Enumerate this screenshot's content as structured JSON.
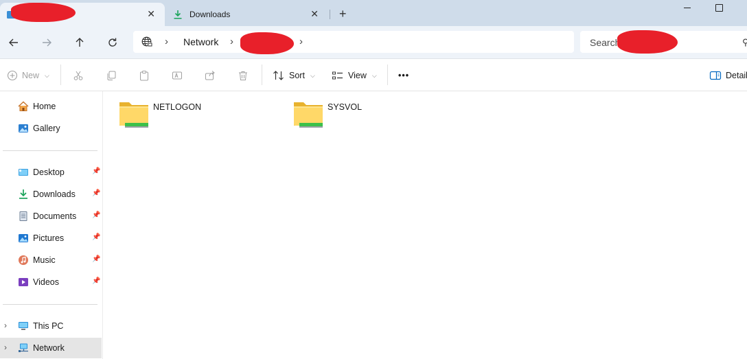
{
  "tabs": [
    {
      "label": "",
      "close": "✕"
    },
    {
      "label": "Downloads",
      "close": "✕"
    }
  ],
  "new_tab": "+",
  "address": {
    "crumbs": [
      "Network"
    ]
  },
  "search": {
    "placeholder": "Search"
  },
  "commands": {
    "new": "New",
    "sort": "Sort",
    "view": "View",
    "more": "•••",
    "details": "Details"
  },
  "sidebar": {
    "top": [
      {
        "label": "Home",
        "icon": "home-icon"
      },
      {
        "label": "Gallery",
        "icon": "gallery-icon"
      }
    ],
    "quick": [
      {
        "label": "Desktop",
        "icon": "desktop-icon"
      },
      {
        "label": "Downloads",
        "icon": "download-icon"
      },
      {
        "label": "Documents",
        "icon": "document-icon"
      },
      {
        "label": "Pictures",
        "icon": "pictures-icon"
      },
      {
        "label": "Music",
        "icon": "music-icon"
      },
      {
        "label": "Videos",
        "icon": "videos-icon"
      }
    ],
    "drives": [
      {
        "label": "This PC",
        "icon": "pc-icon"
      },
      {
        "label": "Network",
        "icon": "network-icon",
        "selected": true
      }
    ]
  },
  "folders": [
    {
      "name": "NETLOGON"
    },
    {
      "name": "SYSVOL"
    }
  ],
  "colors": {
    "accent": "#0067c0",
    "redaction": "#e8202a",
    "folder": "#f5c542",
    "share_bar": "#3cc04a"
  }
}
